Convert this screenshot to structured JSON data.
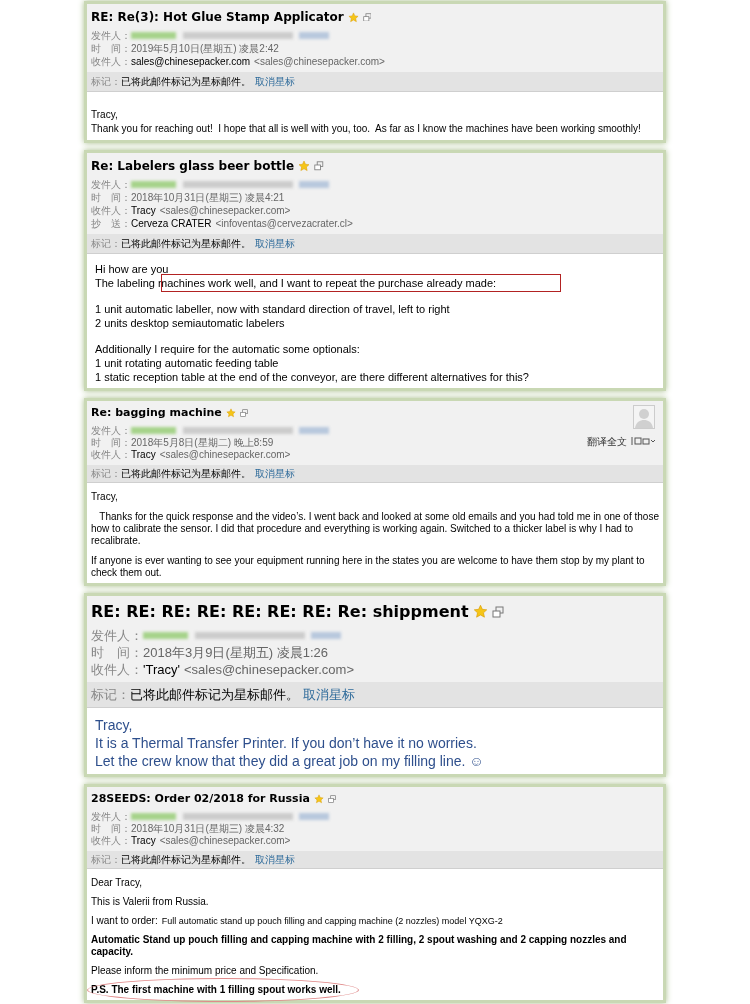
{
  "emails": [
    {
      "kind": "compact",
      "title": "RE: Re(3): Hot Glue Stamp Applicator",
      "fields": [
        {
          "kind": "redacted",
          "label": "发件人："
        },
        {
          "kind": "plain",
          "label": "时　间：",
          "value": "2019年5月10日(星期五) 凌晨2:42"
        },
        {
          "kind": "plain",
          "label": "收件人：",
          "name": "sales@chinesepacker.com",
          "value": "<sales@chinesepacker.com>"
        }
      ],
      "mark_label": "标记：",
      "mark_text": "已将此邮件标记为星标邮件。",
      "unstar_link": "取消星标",
      "body": [
        {
          "text": "Tracy,",
          "gap": true
        },
        {
          "text": "Thank you for reaching out!  I hope that all is well with you, too.  As far as I know the machines have been working smoothly!"
        }
      ]
    },
    {
      "kind": "regular",
      "title": "Re: Labelers glass beer bottle",
      "fields": [
        {
          "kind": "redacted",
          "label": "发件人："
        },
        {
          "kind": "plain",
          "label": "时　间：",
          "value": "2018年10月31日(星期三) 凌晨4:21"
        },
        {
          "kind": "plain",
          "label": "收件人：",
          "name": "Tracy",
          "value": "<sales@chinesepacker.com>"
        },
        {
          "kind": "plain",
          "label": "抄　送：",
          "name": "Cerveza CRATER",
          "value": "<infoventas@cervezacrater.cl>"
        }
      ],
      "mark_label": "标记：",
      "mark_text": "已将此邮件标记为星标邮件。",
      "unstar_link": "取消星标",
      "body": [
        {
          "text": "Hi how are you"
        },
        {
          "text": "The labeling machines work well, and I want to repeat the purchase already made:",
          "boxed": true
        },
        {
          "text": "1 unit automatic labeller, now with standard direction of travel, left to right",
          "gap": true
        },
        {
          "text": "2 units desktop semiautomatic labelers"
        },
        {
          "text": "Additionally I require for the automatic some optionals:",
          "gap": true
        },
        {
          "text": "1 unit rotating automatic feeding table"
        },
        {
          "text": "1 static reception table at the end of the conveyor, are there different alternatives for this?"
        }
      ]
    },
    {
      "kind": "narrow",
      "title": "Re: bagging machine",
      "translate_link": "翻译全文",
      "fields": [
        {
          "kind": "redacted",
          "label": "发件人："
        },
        {
          "kind": "plain",
          "label": "时　间：",
          "value": "2018年5月8日(星期二) 晚上8:59"
        },
        {
          "kind": "plain",
          "label": "收件人：",
          "name": "Tracy",
          "value": "<sales@chinesepacker.com>"
        }
      ],
      "mark_label": "标记：",
      "mark_text": "已将此邮件标记为星标邮件。",
      "unstar_link": "取消星标",
      "body": [
        {
          "text": "Tracy,"
        },
        {
          "text": "   Thanks for the quick response and the video’s. I went back and looked at some old emails and you had told me in one of those how to calibrate the sensor. I did that procedure and everything is working again. Switched to a thicker label is why I had to recalibrate.",
          "gap": true
        },
        {
          "text": "If anyone is ever wanting to see your equipment running here in the states you are welcome to have them stop by my plant to check them out.",
          "gap": true
        }
      ]
    },
    {
      "kind": "large",
      "title": "RE: RE: RE: RE: RE: RE: RE: Re: shippment",
      "fields": [
        {
          "kind": "redacted",
          "label": "发件人："
        },
        {
          "kind": "plain",
          "label": "时　间：",
          "value": "2018年3月9日(星期五) 凌晨1:26"
        },
        {
          "kind": "plain",
          "label": "收件人：",
          "name": "'Tracy'",
          "value": "<sales@chinesepacker.com>"
        }
      ],
      "mark_label": "标记：",
      "mark_text": "已将此邮件标记为星标邮件。",
      "unstar_link": "取消星标",
      "body": [
        {
          "text": "Tracy,"
        },
        {
          "text": "It is a Thermal Transfer Printer. If you don’t have it no worries."
        },
        {
          "text": "Let the crew know that they did a great job on my filling line. ☺"
        }
      ]
    },
    {
      "kind": "tiny",
      "title": "28SEEDS: Order 02/2018 for Russia",
      "fields": [
        {
          "kind": "redacted",
          "label": "发件人："
        },
        {
          "kind": "plain",
          "label": "时　间：",
          "value": "2018年10月31日(星期三) 凌晨4:32"
        },
        {
          "kind": "plain",
          "label": "收件人：",
          "name": "Tracy",
          "value": "<sales@chinesepacker.com>"
        }
      ],
      "mark_label": "标记：",
      "mark_text": "已将此邮件标记为星标邮件。",
      "unstar_link": "取消星标",
      "body": [
        {
          "text": "Dear Tracy,"
        },
        {
          "text": "This is Valerii from Russia.",
          "gap": true
        },
        {
          "text": "I want to order:",
          "detail": "Full automatic stand up pouch filling and capping machine (2 nozzles) model YQXG-2",
          "gap": true
        },
        {
          "text": "Automatic Stand up pouch filling and capping machine with 2 filling, 2 spout washing and 2 capping nozzles and capacity.",
          "bold": true,
          "gap": true
        },
        {
          "text": "Please inform the minimum price and Specification.",
          "gap": true
        },
        {
          "text": "P.S. The first machine with 1 filling spout works well.",
          "bold": true,
          "circled": true,
          "gap": true
        }
      ]
    }
  ]
}
